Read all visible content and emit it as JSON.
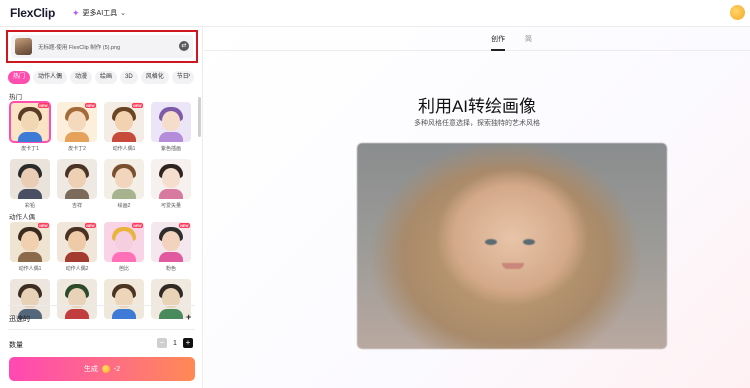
{
  "header": {
    "logo": "FlexClip",
    "ai_tools_label": "更多AI工具"
  },
  "upload": {
    "filename": "无标题-使用 FlexClip 制作 (5).png"
  },
  "style_tabs": [
    "热门",
    "动作人偶",
    "动漫",
    "绘画",
    "3D",
    "风格化",
    "节日"
  ],
  "sections": {
    "popular_title": "热门",
    "popular": [
      {
        "label": "皮卡丁1",
        "new": true
      },
      {
        "label": "皮卡丁2",
        "new": true
      },
      {
        "label": "动作人偶1",
        "new": true
      },
      {
        "label": "紫色插画",
        "new": false
      },
      {
        "label": "彩铅",
        "new": false
      },
      {
        "label": "吉祥",
        "new": false
      },
      {
        "label": "绘画2",
        "new": false
      },
      {
        "label": "可爱矢量",
        "new": false
      }
    ],
    "figure_title": "动作人偶",
    "figures": [
      {
        "label": "动作人偶1",
        "new": true
      },
      {
        "label": "动作人偶2",
        "new": true
      },
      {
        "label": "芭比",
        "new": true
      },
      {
        "label": "粉色",
        "new": true
      },
      {
        "label": "",
        "new": false
      },
      {
        "label": "",
        "new": false
      },
      {
        "label": "",
        "new": false
      },
      {
        "label": "",
        "new": false
      }
    ]
  },
  "options": {
    "advanced_label": "迅速的",
    "quantity_label": "数量",
    "quantity_value": "1"
  },
  "generate": {
    "label": "生成",
    "cost": "-2"
  },
  "main": {
    "tabs": [
      "创作",
      "简"
    ],
    "headline": "利用AI转绘画像",
    "subheadline": "多种风格任意选择，探索独特的艺术风格"
  },
  "colors": {
    "accent_pink": "#ff4fae",
    "highlight_red": "#d0161e"
  }
}
